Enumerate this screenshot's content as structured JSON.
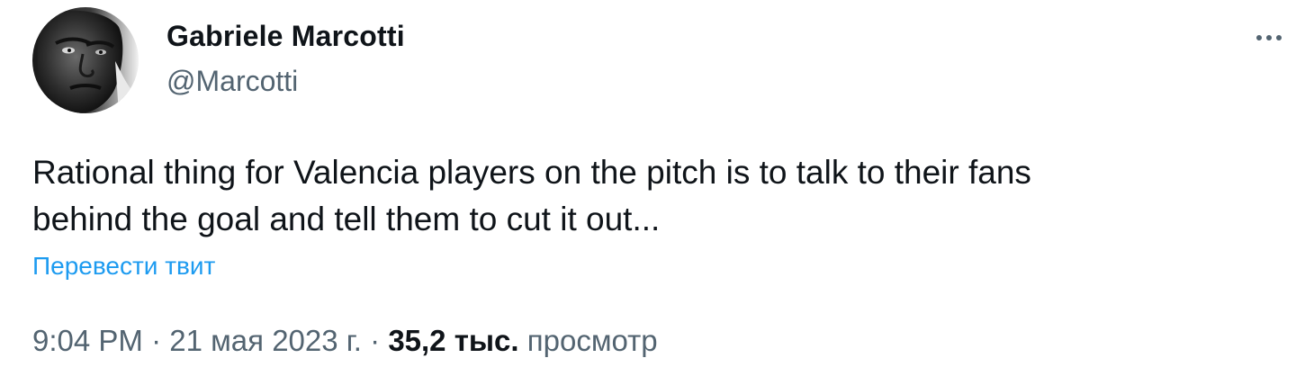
{
  "tweet": {
    "author": {
      "display_name": "Gabriele Marcotti",
      "handle": "@Marcotti",
      "avatar_icon": "profile-photo"
    },
    "more_icon": "more-horizontal-icon",
    "text": "Rational thing for Valencia players on the pitch is to talk to their fans\nbehind the goal and tell them to cut it out...",
    "translate_label": "Перевести твит",
    "time": "9:04 PM",
    "separator": "·",
    "date": "21 мая 2023 г.",
    "views_count": "35,2 тыс.",
    "views_label": "просмотр"
  },
  "colors": {
    "text_primary": "#0f1419",
    "text_secondary": "#536471",
    "link": "#1d9bf0"
  }
}
